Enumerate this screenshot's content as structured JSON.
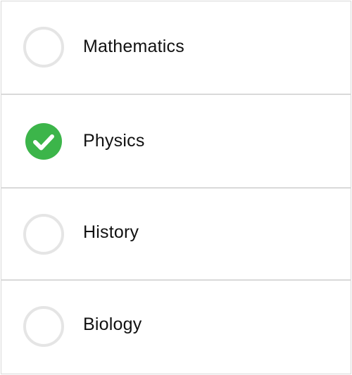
{
  "options": [
    {
      "label": "Mathematics",
      "checked": false
    },
    {
      "label": "Physics",
      "checked": true
    },
    {
      "label": "History",
      "checked": false
    },
    {
      "label": "Biology",
      "checked": false
    }
  ],
  "colors": {
    "checked_fill": "#3cb54a",
    "check_mark": "#ffffff",
    "unchecked_ring": "#e5e5e5",
    "divider": "#d9d9d9"
  }
}
